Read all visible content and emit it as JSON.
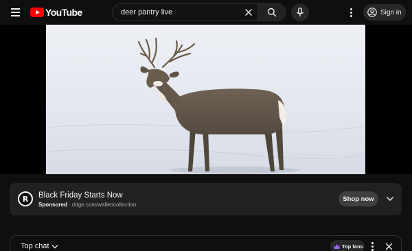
{
  "header": {
    "logo_text": "YouTube",
    "search": {
      "value": "deer pantry live",
      "placeholder": "Search"
    },
    "signin_label": "Sign in"
  },
  "video": {
    "subject": "buck-in-snow"
  },
  "ad": {
    "logo_letter": "R",
    "title": "Black Friday Starts Now",
    "sponsored_label": "Sponsored",
    "separator": " · ",
    "url": "ridge.com/wallet/collection",
    "cta_label": "Shop now"
  },
  "chat": {
    "title": "Top chat",
    "top_fans_label": "Top fans"
  },
  "colors": {
    "background": "#0f0f0f",
    "brand_red": "#ff0000",
    "card": "#212121",
    "button": "#3f3f3f",
    "crown": "#9b6bff"
  },
  "icons": [
    "menu-icon",
    "youtube-logo-icon",
    "clear-icon",
    "search-icon",
    "mic-icon",
    "more-vert-icon",
    "account-icon",
    "chevron-down-icon",
    "crown-icon",
    "close-icon"
  ]
}
